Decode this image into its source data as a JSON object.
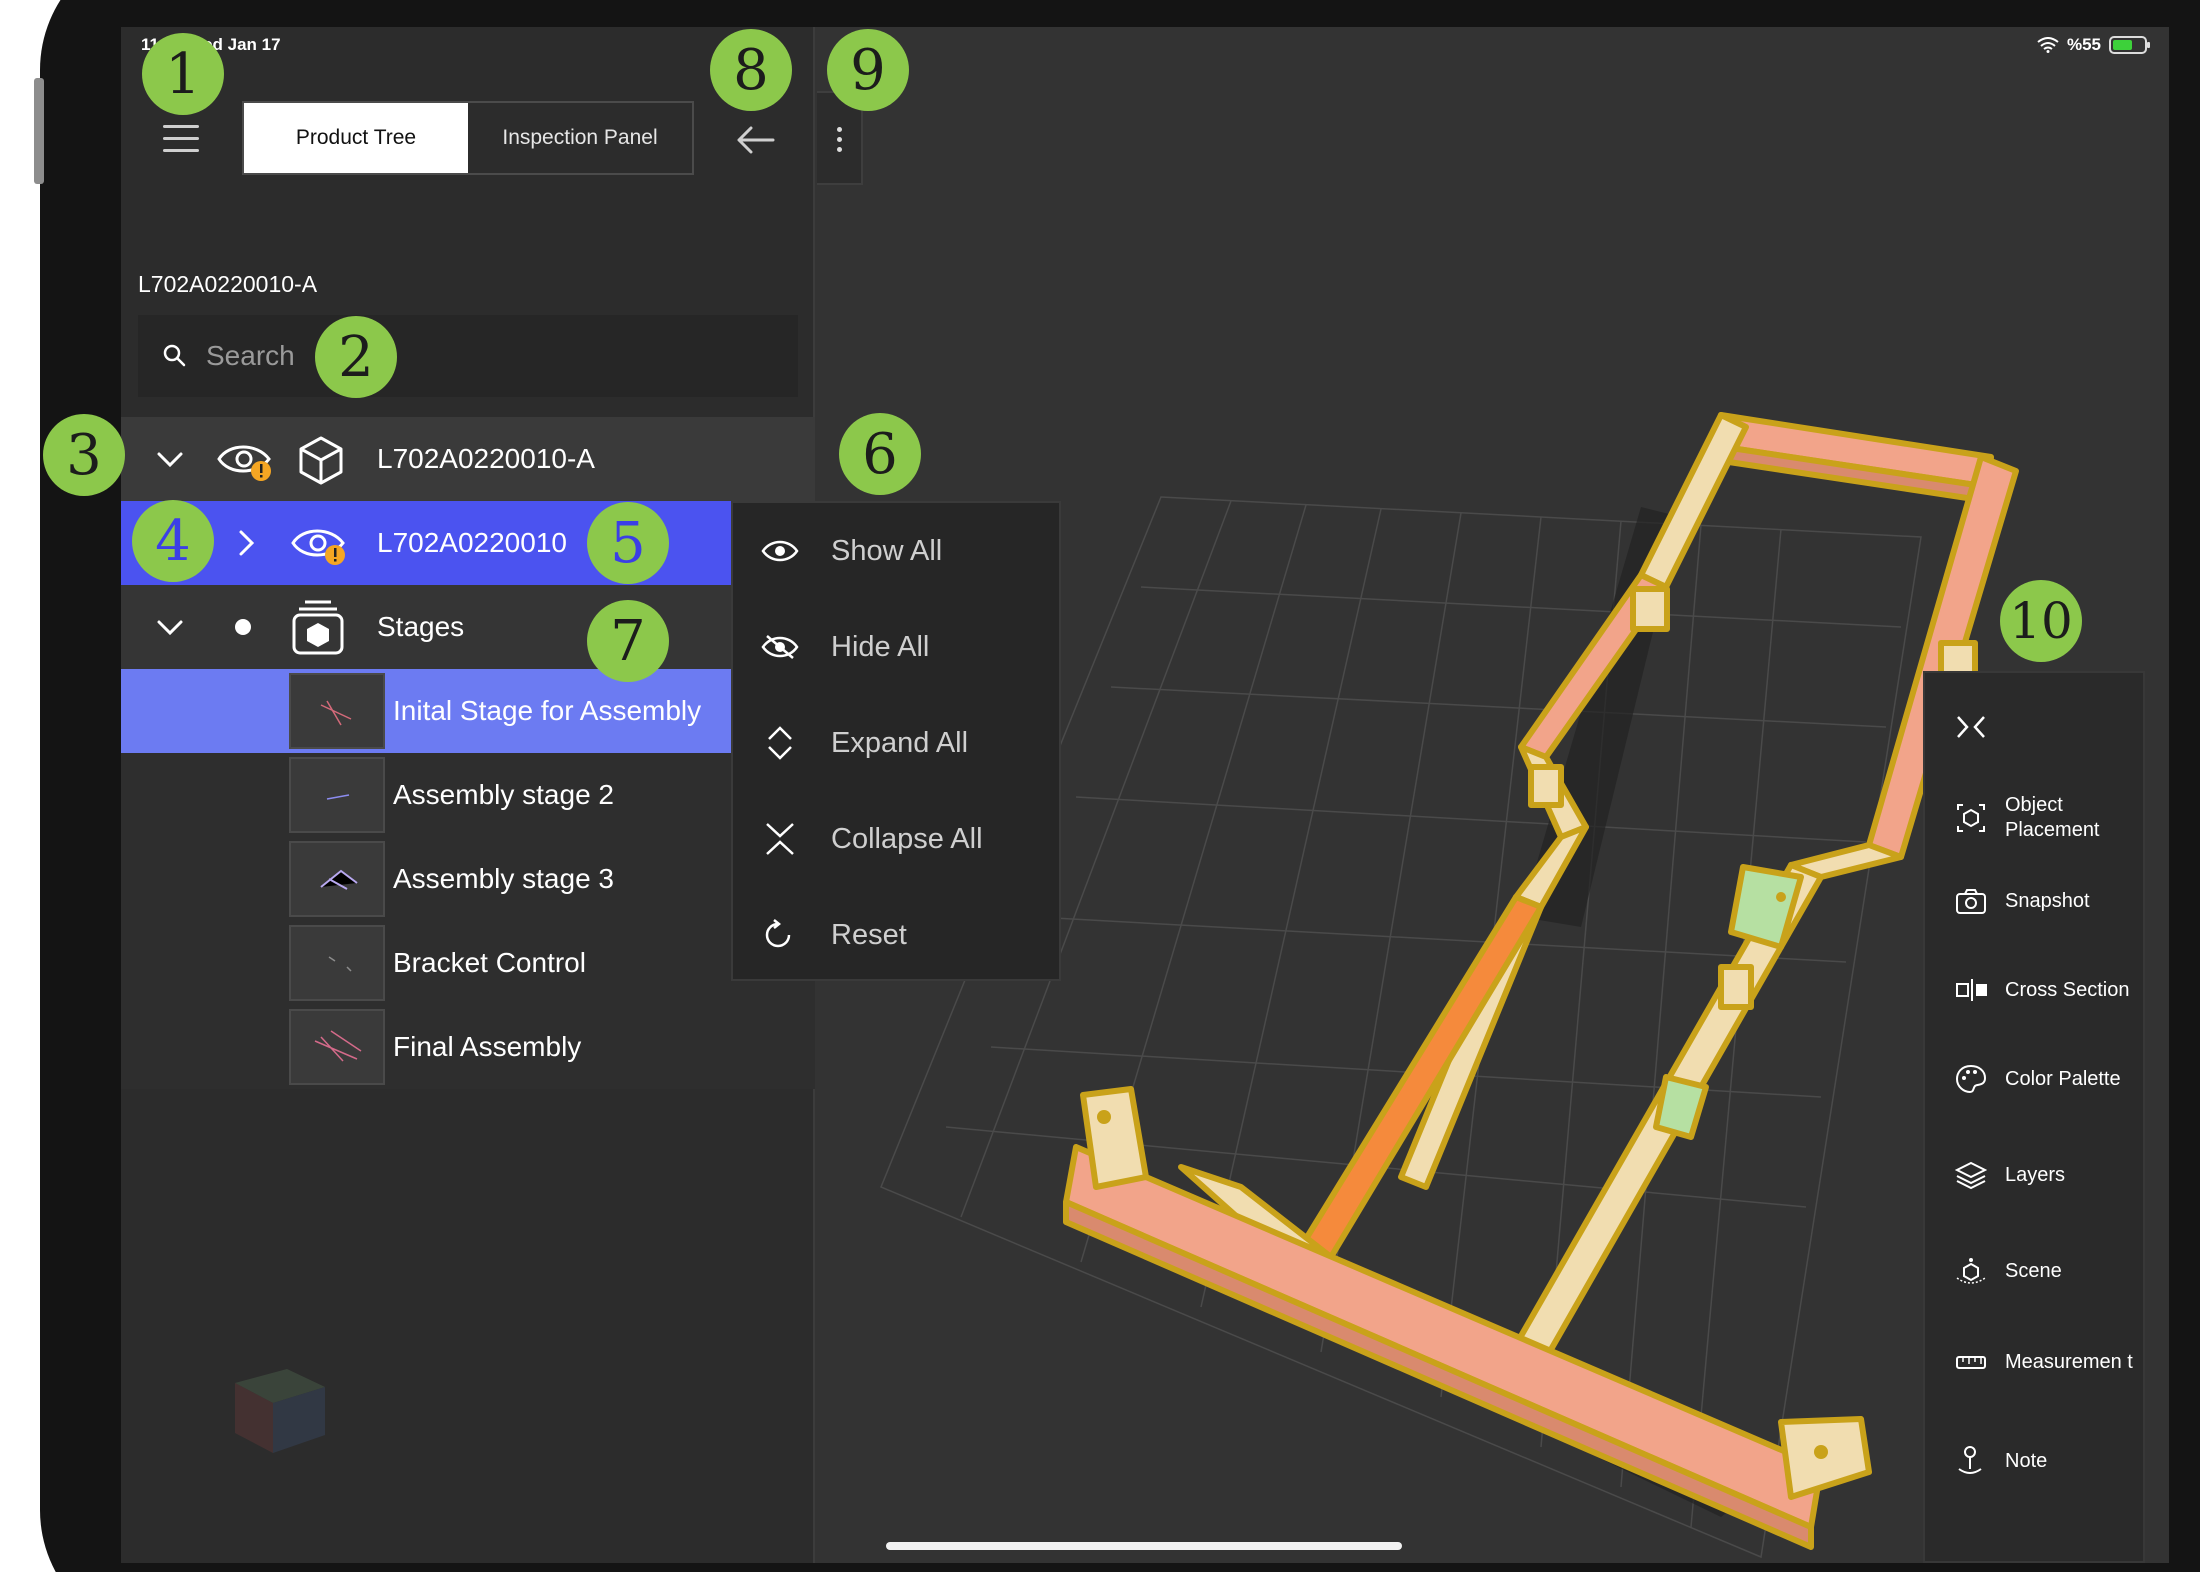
{
  "status_bar": {
    "time": "11:11  Wed Jan 17",
    "battery": "%55"
  },
  "header": {
    "tabs": [
      {
        "label": "Product Tree",
        "active": true
      },
      {
        "label": "Inspection Panel",
        "active": false
      }
    ]
  },
  "model": {
    "id": "L702A0220010-A"
  },
  "search": {
    "placeholder": "Search"
  },
  "tree": {
    "root": {
      "label": "L702A0220010-A"
    },
    "sub": {
      "label": "L702A0220010"
    },
    "stages": {
      "label": "Stages"
    },
    "stage_items": [
      {
        "label": "Inital Stage for Assembly",
        "selected": true
      },
      {
        "label": "Assembly stage 2"
      },
      {
        "label": "Assembly stage 3"
      },
      {
        "label": "Bracket Control"
      },
      {
        "label": "Final Assembly"
      }
    ]
  },
  "context_menu": {
    "items": [
      {
        "label": "Show All",
        "icon": "eye-icon"
      },
      {
        "label": "Hide All",
        "icon": "eye-off-icon"
      },
      {
        "label": "Expand All",
        "icon": "expand-icon"
      },
      {
        "label": "Collapse All",
        "icon": "collapse-icon"
      },
      {
        "label": "Reset",
        "icon": "reset-icon"
      }
    ]
  },
  "toolbar": {
    "items": [
      {
        "label": "Object Placement",
        "icon": "object-placement-icon"
      },
      {
        "label": "Snapshot",
        "icon": "camera-icon"
      },
      {
        "label": "Cross Section",
        "icon": "cross-section-icon"
      },
      {
        "label": "Color Palette",
        "icon": "palette-icon"
      },
      {
        "label": "Layers",
        "icon": "layers-icon"
      },
      {
        "label": "Scene",
        "icon": "scene-icon"
      },
      {
        "label": "Measuremen t",
        "icon": "ruler-icon"
      },
      {
        "label": "Note",
        "icon": "note-pin-icon"
      }
    ]
  },
  "callouts": [
    "1",
    "2",
    "3",
    "4",
    "5",
    "6",
    "7",
    "8",
    "9",
    "10"
  ],
  "colors": {
    "selection_blue": "#4b53f0",
    "stage_selected": "#6c7bf2",
    "callout_green": "#8cc84b",
    "frame_pink": "#f2a48a",
    "frame_beige": "#f1ddb0",
    "frame_orange": "#f58a3c",
    "frame_outline": "#c9a21a"
  }
}
